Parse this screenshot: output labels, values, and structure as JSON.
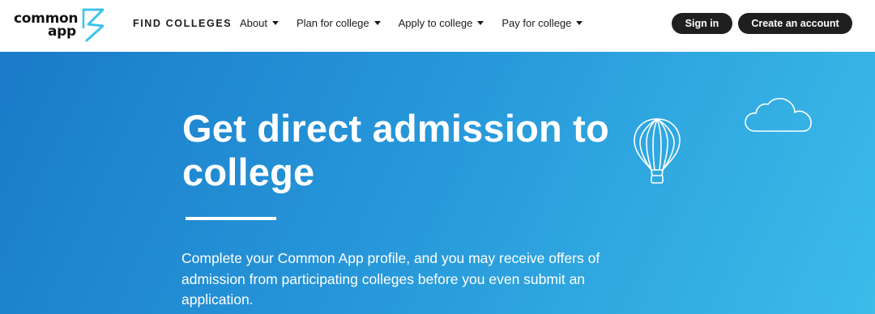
{
  "header": {
    "logo": {
      "line1": "common",
      "line2": "app"
    },
    "find_colleges": "FIND COLLEGES",
    "nav": [
      {
        "label": "About"
      },
      {
        "label": "Plan for college"
      },
      {
        "label": "Apply to college"
      },
      {
        "label": "Pay for college"
      }
    ],
    "sign_in": "Sign in",
    "create_account": "Create an account"
  },
  "hero": {
    "title": "Get direct admission to college",
    "body": "Complete your Common App profile, and you may receive offers of admission from participating colleges before you even submit an application.",
    "icons": [
      "hot-air-balloon-icon",
      "cloud-icon"
    ]
  },
  "colors": {
    "brand_dark": "#1f1f1f",
    "hero_gradient_start": "#1a7bc9",
    "hero_gradient_end": "#3bbce9",
    "logo_accent": "#3cc3ee"
  }
}
